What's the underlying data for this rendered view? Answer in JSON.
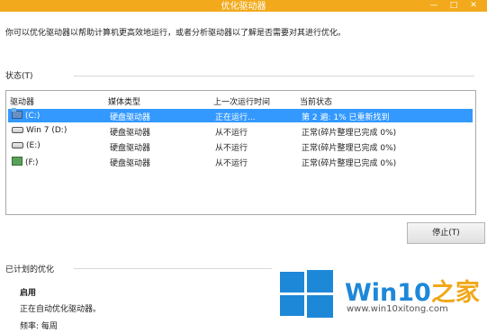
{
  "window": {
    "title": "优化驱动器",
    "min_glyph": "—",
    "max_glyph": "□",
    "close_glyph": "✕"
  },
  "description": "你可以优化驱动器以帮助计算机更高效地运行，或者分析驱动器以了解是否需要对其进行优化。",
  "status_section": {
    "label": "状态(T)"
  },
  "table": {
    "headers": [
      "驱动器",
      "媒体类型",
      "上一次运行时间",
      "当前状态"
    ],
    "rows": [
      {
        "drive": "(C:)",
        "media": "硬盘驱动器",
        "last_run": "正在运行...",
        "status": "第 2 遍: 1% 已重新找到",
        "icon": "system-drive-icon",
        "selected": true
      },
      {
        "drive": "Win 7 (D:)",
        "media": "硬盘驱动器",
        "last_run": "从不运行",
        "status": "正常(碎片整理已完成 0%)",
        "icon": "hard-drive-icon",
        "selected": false
      },
      {
        "drive": "(E:)",
        "media": "硬盘驱动器",
        "last_run": "从不运行",
        "status": "正常(碎片整理已完成 0%)",
        "icon": "hard-drive-icon",
        "selected": false
      },
      {
        "drive": "(F:)",
        "media": "硬盘驱动器",
        "last_run": "从不运行",
        "status": "正常(碎片整理已完成 0%)",
        "icon": "removable-drive-icon",
        "selected": false
      }
    ]
  },
  "buttons": {
    "stop": "停止(T)"
  },
  "scheduled": {
    "title": "已计划的优化",
    "enabled": "启用",
    "auto_text": "正在自动优化驱动器。",
    "frequency": "频率: 每周"
  },
  "watermark": {
    "brand_main": "Win10",
    "brand_accent": "之家",
    "url": "www.win10xitong.com"
  },
  "colors": {
    "titlebar": "#f2aa1c",
    "selection": "#3399ff",
    "logo_blue": "#1e88d8",
    "logo_orange": "#f0a81a"
  }
}
